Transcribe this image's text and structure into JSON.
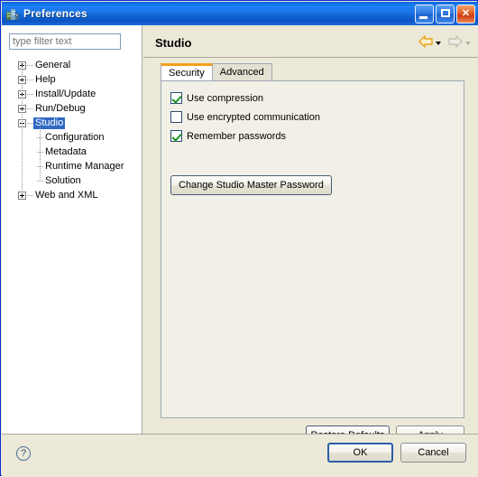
{
  "window": {
    "title": "Preferences",
    "icon": "building-icon",
    "controls": {
      "minimize": "Minimize",
      "maximize": "Maximize",
      "close": "Close"
    },
    "titlebar_color": "#1673e8",
    "body_color": "#ece9d8"
  },
  "sidebar": {
    "filter": {
      "value": "",
      "placeholder": "type filter text"
    },
    "tree": [
      {
        "label": "General",
        "expander": "plus",
        "level": 0,
        "selected": false
      },
      {
        "label": "Help",
        "expander": "plus",
        "level": 0,
        "selected": false
      },
      {
        "label": "Install/Update",
        "expander": "plus",
        "level": 0,
        "selected": false
      },
      {
        "label": "Run/Debug",
        "expander": "plus",
        "level": 0,
        "selected": false
      },
      {
        "label": "Studio",
        "expander": "minus",
        "level": 0,
        "selected": true
      },
      {
        "label": "Configuration",
        "expander": "none",
        "level": 1,
        "selected": false
      },
      {
        "label": "Metadata",
        "expander": "none",
        "level": 1,
        "selected": false
      },
      {
        "label": "Runtime Manager",
        "expander": "none",
        "level": 1,
        "selected": false
      },
      {
        "label": "Solution",
        "expander": "none",
        "level": 1,
        "selected": false
      },
      {
        "label": "Web and XML",
        "expander": "plus",
        "level": 0,
        "selected": false
      }
    ]
  },
  "main": {
    "title": "Studio",
    "nav": {
      "back": "back-arrow",
      "back_enabled": true,
      "back_color": "#e8a317",
      "forward": "forward-arrow",
      "forward_enabled": false,
      "forward_color": "#cccabe"
    },
    "tabs": [
      {
        "label": "Security",
        "active": true
      },
      {
        "label": "Advanced",
        "active": false
      }
    ],
    "active_tab_accent": "#f2a01e",
    "security": {
      "checkboxes": [
        {
          "label": "Use compression",
          "checked": true
        },
        {
          "label": "Use encrypted communication",
          "checked": false
        },
        {
          "label": "Remember passwords",
          "checked": true
        }
      ],
      "master_password_button": "Change Studio Master Password"
    },
    "restore_defaults_label": "Restore Defaults",
    "apply_label": "Apply"
  },
  "footer": {
    "help_icon": "?",
    "ok_label": "OK",
    "cancel_label": "Cancel"
  }
}
